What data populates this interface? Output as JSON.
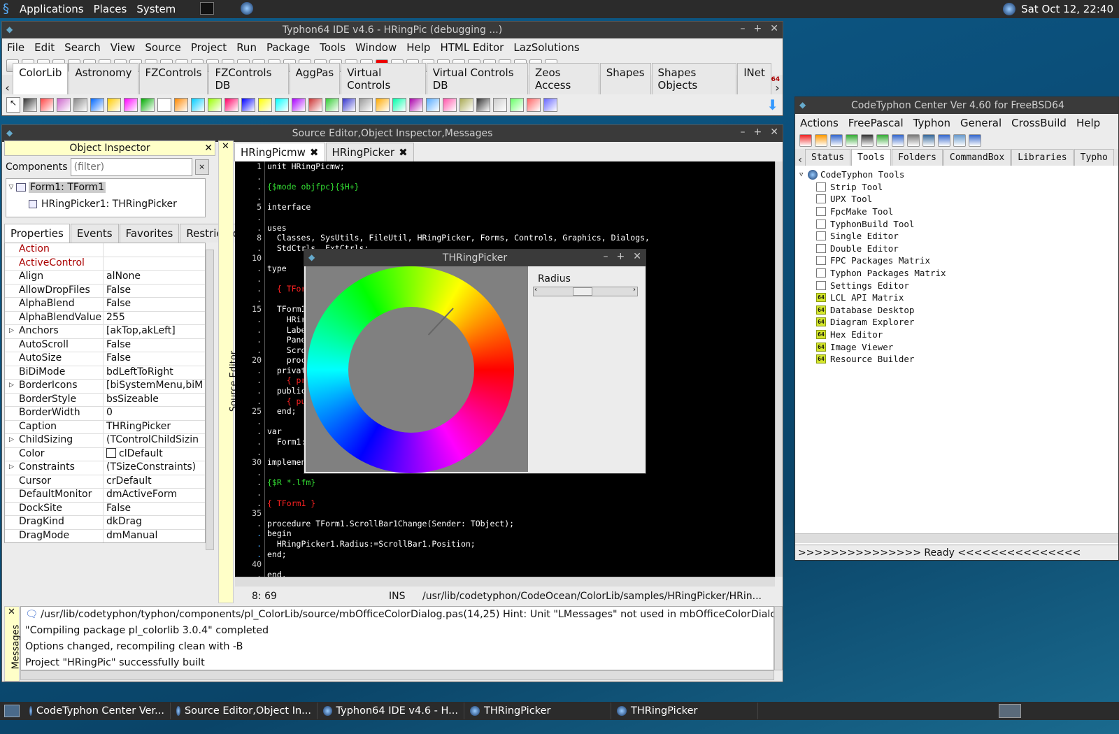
{
  "top_panel": {
    "menu": [
      "Applications",
      "Places",
      "System"
    ],
    "clock": "Sat Oct 12, 22:40"
  },
  "ide": {
    "title": "Typhon64 IDE v4.6 - HRingPic (debugging ...)",
    "menu": [
      "File",
      "Edit",
      "Search",
      "View",
      "Source",
      "Project",
      "Run",
      "Package",
      "Tools",
      "Window",
      "Help",
      "HTML Editor",
      "LazSolutions"
    ],
    "palette_tabs": [
      "ColorLib",
      "Astronomy",
      "FZControls",
      "FZControls DB",
      "AggPas",
      "Virtual Controls",
      "Virtual Controls DB",
      "Zeos Access",
      "Shapes",
      "Shapes Objects",
      "lNet"
    ]
  },
  "source_window": {
    "title": "Source Editor,Object Inspector,Messages",
    "object_inspector": {
      "title": "Object Inspector",
      "components_label": "Components",
      "filter_placeholder": "(filter)",
      "tree": [
        "Form1: TForm1",
        "HRingPicker1: THRingPicker"
      ],
      "tabs": [
        "Properties",
        "Events",
        "Favorites",
        "Restricted"
      ],
      "properties": [
        {
          "name": "Action",
          "value": "",
          "red": true
        },
        {
          "name": "ActiveControl",
          "value": "",
          "red": true
        },
        {
          "name": "Align",
          "value": "alNone"
        },
        {
          "name": "AllowDropFiles",
          "value": "False"
        },
        {
          "name": "AlphaBlend",
          "value": "False"
        },
        {
          "name": "AlphaBlendValue",
          "value": "255"
        },
        {
          "name": "Anchors",
          "value": "[akTop,akLeft]",
          "expand": true
        },
        {
          "name": "AutoScroll",
          "value": "False"
        },
        {
          "name": "AutoSize",
          "value": "False"
        },
        {
          "name": "BiDiMode",
          "value": "bdLeftToRight"
        },
        {
          "name": "BorderIcons",
          "value": "[biSystemMenu,biM",
          "expand": true
        },
        {
          "name": "BorderStyle",
          "value": "bsSizeable"
        },
        {
          "name": "BorderWidth",
          "value": "0"
        },
        {
          "name": "Caption",
          "value": "THRingPicker"
        },
        {
          "name": "ChildSizing",
          "value": "(TControlChildSizin",
          "expand": true
        },
        {
          "name": "Color",
          "value": "clDefault"
        },
        {
          "name": "Constraints",
          "value": "(TSizeConstraints)",
          "expand": true
        },
        {
          "name": "Cursor",
          "value": "crDefault"
        },
        {
          "name": "DefaultMonitor",
          "value": "dmActiveForm"
        },
        {
          "name": "DockSite",
          "value": "False"
        },
        {
          "name": "DragKind",
          "value": "dkDrag"
        },
        {
          "name": "DragMode",
          "value": "dmManual"
        }
      ]
    },
    "editor_side_label": "Source Editor",
    "editor_tabs": [
      "HRingPicmw",
      "HRingPicker"
    ],
    "gutter": [
      "1",
      ".",
      ".",
      ".",
      "5",
      ".",
      ".",
      "8",
      ".",
      "10",
      ".",
      ".",
      ".",
      ".",
      "15",
      ".",
      ".",
      ".",
      ".",
      "20",
      ".",
      ".",
      ".",
      ".",
      "25",
      ".",
      ".",
      ".",
      ".",
      "30",
      ".",
      ".",
      ".",
      ".",
      "35",
      ".",
      ".",
      ".",
      ".",
      "40",
      "."
    ],
    "code_lines": [
      {
        "t": "unit HRingPicmw;",
        "c": "#ffffff"
      },
      {
        "t": "",
        "c": "#ffffff"
      },
      {
        "t": "{$mode objfpc}{$H+}",
        "c": "#33dd33"
      },
      {
        "t": "",
        "c": "#ffffff"
      },
      {
        "t": "interface",
        "c": "#ffffff"
      },
      {
        "t": "",
        "c": "#ffffff"
      },
      {
        "t": "uses",
        "c": "#ffffff"
      },
      {
        "t": "  Classes, SysUtils, FileUtil, HRingPicker, Forms, Controls, Graphics, Dialogs,",
        "c": "#ffffff"
      },
      {
        "t": "  StdCtrls, ExtCtrls;",
        "c": "#ffffff"
      },
      {
        "t": "",
        "c": "#ffffff"
      },
      {
        "t": "type",
        "c": "#ffffff"
      },
      {
        "t": "",
        "c": "#ffffff"
      },
      {
        "t": "  { TFor",
        "c": "#ff2222"
      },
      {
        "t": "",
        "c": "#ffffff"
      },
      {
        "t": "  TForm1",
        "c": "#ffffff"
      },
      {
        "t": "    HRir",
        "c": "#ffffff"
      },
      {
        "t": "    Labe",
        "c": "#ffffff"
      },
      {
        "t": "    Pane",
        "c": "#ffffff"
      },
      {
        "t": "    Scro",
        "c": "#ffffff"
      },
      {
        "t": "    proc",
        "c": "#ffffff"
      },
      {
        "t": "  privat",
        "c": "#ffffff"
      },
      {
        "t": "    { pr",
        "c": "#ff2222"
      },
      {
        "t": "  public",
        "c": "#ffffff"
      },
      {
        "t": "    { pu",
        "c": "#ff2222"
      },
      {
        "t": "  end;",
        "c": "#ffffff"
      },
      {
        "t": "",
        "c": "#ffffff"
      },
      {
        "t": "var",
        "c": "#ffffff"
      },
      {
        "t": "  Form1:",
        "c": "#ffffff"
      },
      {
        "t": "",
        "c": "#ffffff"
      },
      {
        "t": "implemen",
        "c": "#ffffff"
      },
      {
        "t": "",
        "c": "#ffffff"
      },
      {
        "t": "{$R *.lfm}",
        "c": "#33dd33"
      },
      {
        "t": "",
        "c": "#ffffff"
      },
      {
        "t": "{ TForm1 }",
        "c": "#ff2222"
      },
      {
        "t": "",
        "c": "#ffffff"
      },
      {
        "t": "procedure TForm1.ScrollBar1Change(Sender: TObject);",
        "c": "#ffffff"
      },
      {
        "t": "begin",
        "c": "#ffffff"
      },
      {
        "t": "  HRingPicker1.Radius:=ScrollBar1.Position;",
        "c": "#ffffff"
      },
      {
        "t": "end;",
        "c": "#ffffff"
      },
      {
        "t": "",
        "c": "#ffffff"
      },
      {
        "t": "end.",
        "c": "#ffffff"
      }
    ],
    "status": {
      "pos": "8: 69",
      "mode": "INS",
      "file": "/usr/lib/codetyphon/CodeOcean/ColorLib/samples/HRingPicker/HRin..."
    },
    "messages_label": "Messages",
    "messages": [
      "/usr/lib/codetyphon/typhon/components/pl_ColorLib/source/mbOfficeColorDialog.pas(14,25) Hint: Unit \"LMessages\" not used in mbOfficeColorDialog",
      "\"Compiling package pl_colorlib 3.0.4\" completed",
      "Options changed, recompiling clean with -B",
      "Project \"HRingPic\" successfully built"
    ]
  },
  "picker_window": {
    "title": "THRingPicker",
    "radius_label": "Radius"
  },
  "center_window": {
    "title": "CodeTyphon Center Ver 4.60 for FreeBSD64",
    "menu": [
      "Actions",
      "FreePascal",
      "Typhon",
      "General",
      "CrossBuild",
      "Help"
    ],
    "tabs": [
      "Status",
      "Tools",
      "Folders",
      "CommandBox",
      "Libraries",
      "Typho"
    ],
    "root": "CodeTyphon Tools",
    "items": [
      {
        "label": "Strip Tool",
        "icon": "w"
      },
      {
        "label": "UPX Tool",
        "icon": "w"
      },
      {
        "label": "FpcMake Tool",
        "icon": "w"
      },
      {
        "label": "TyphonBuild Tool",
        "icon": "w"
      },
      {
        "label": "Single Editor",
        "icon": "w"
      },
      {
        "label": "Double Editor",
        "icon": "w"
      },
      {
        "label": "FPC Packages Matrix",
        "icon": "w"
      },
      {
        "label": "Typhon Packages Matrix",
        "icon": "w"
      },
      {
        "label": "Settings Editor",
        "icon": "w"
      },
      {
        "label": "LCL API Matrix",
        "icon": "y"
      },
      {
        "label": "Database Desktop",
        "icon": "y"
      },
      {
        "label": "Diagram Explorer",
        "icon": "y"
      },
      {
        "label": "Hex Editor",
        "icon": "y"
      },
      {
        "label": "Image Viewer",
        "icon": "y"
      },
      {
        "label": "Resource Builder",
        "icon": "y"
      }
    ],
    "status": ">>>>>>>>>>>>>>> Ready <<<<<<<<<<<<<<<"
  },
  "taskbar": [
    "CodeTyphon Center Ver...",
    "Source Editor,Object In...",
    "Typhon64 IDE v4.6 - H...",
    "THRingPicker",
    "THRingPicker"
  ]
}
